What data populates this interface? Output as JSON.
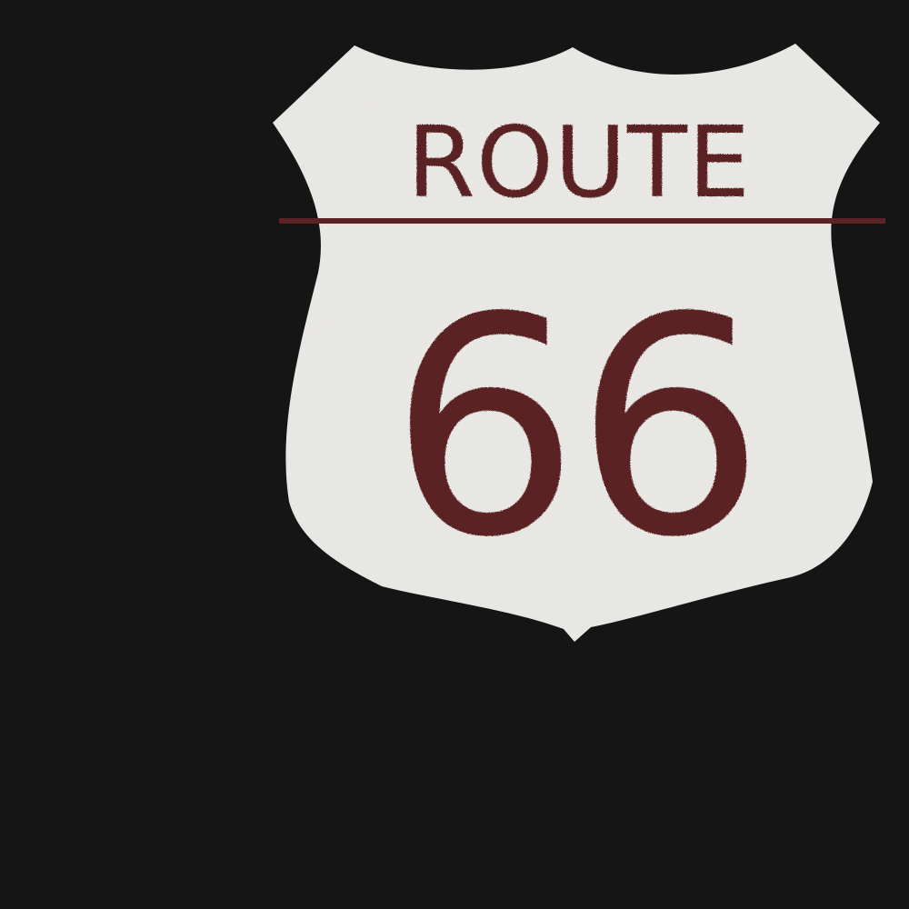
{
  "background_color": "#151516",
  "sign": {
    "shape": "us-route-shield",
    "face_color": "#ecebe8",
    "ink_color": "#5a2424",
    "top_text": "ROUTE",
    "number_text": "66"
  }
}
